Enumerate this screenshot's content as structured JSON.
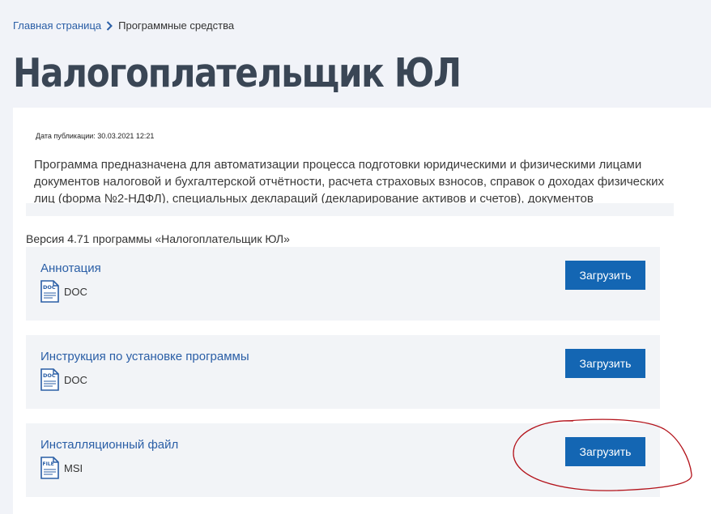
{
  "breadcrumb": {
    "home": "Главная страница",
    "current": "Программные средства"
  },
  "page": {
    "title": "Налогоплательщик ЮЛ"
  },
  "card": {
    "pub_date": "Дата публикации: 30.03.2021 12:21",
    "description": "Программа предназначена для автоматизации процесса подготовки юридическими и физическими лицами документов налоговой и бухгалтерской отчётности, расчета страховых взносов, справок о доходах физических лиц (форма №2-НДФЛ), специальных деклараций (декларирование активов и счетов), документов",
    "version": "Версия 4.71 программы «Налогоплательщик ЮЛ»"
  },
  "files": [
    {
      "title": "Аннотация",
      "icon_label": "DOC",
      "type": "DOC",
      "button": "Загрузить"
    },
    {
      "title": "Инструкция по установке программы",
      "icon_label": "DOC",
      "type": "DOC",
      "button": "Загрузить"
    },
    {
      "title": "Инсталляционный файл",
      "icon_label": "FILE",
      "type": "MSI",
      "button": "Загрузить"
    }
  ],
  "colors": {
    "accent": "#1466b3",
    "link": "#2a5ea6",
    "title": "#3a4655",
    "annotation": "#b3121a"
  },
  "icons": {
    "breadcrumb_separator": "chevron-right-icon",
    "file": "document-icon"
  }
}
